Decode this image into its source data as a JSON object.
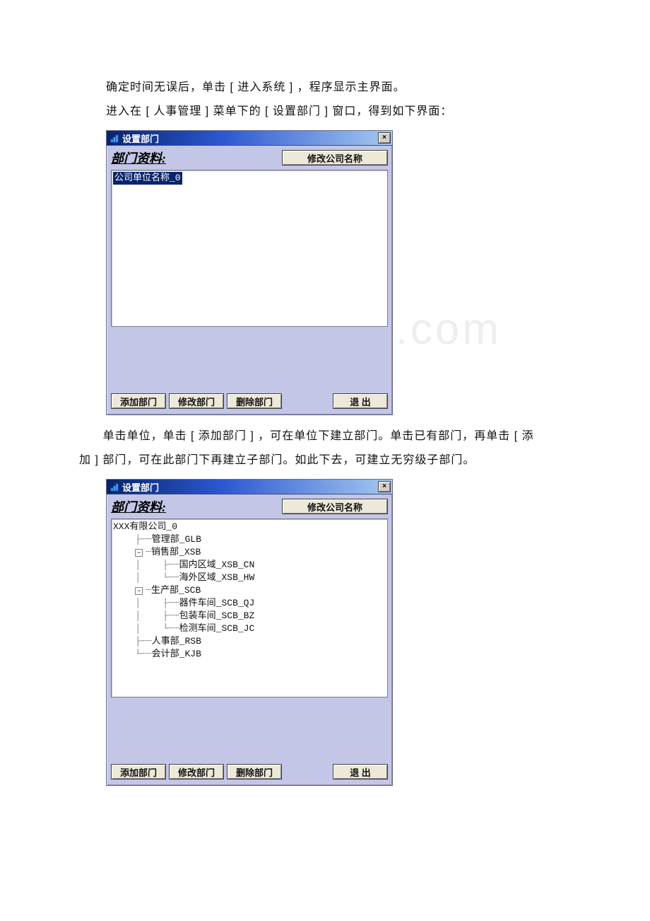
{
  "doc": {
    "line1": "确定时间无误后，单击 [ 进入系统 ] ，程序显示主界面。",
    "line2": "进入在 [ 人事管理 ] 菜单下的 [ 设置部门 ] 窗口，得到如下界面：",
    "line_mid_a": "单击单位，单击 [ 添加部门 ] ，可在单位下建立部门。单击已有部门，再单击 [ 添",
    "line_mid_b": "加 ] 部门，可在此部门下再建立子部门。如此下去，可建立无穷级子部门。",
    "watermark": "www.bdocx.com"
  },
  "dialog1": {
    "title": "设置部门",
    "close": "×",
    "label": "部门资料:",
    "modify_company": "修改公司名称",
    "tree_selected": "公司单位名称_0",
    "btn_add": "添加部门",
    "btn_edit": "修改部门",
    "btn_del": "删除部门",
    "btn_exit": "退 出"
  },
  "dialog2": {
    "title": "设置部门",
    "close": "×",
    "label": "部门资料:",
    "modify_company": "修改公司名称",
    "tree": {
      "root": "XXX有限公司_0",
      "n1": "管理部_GLB",
      "n2": "销售部_XSB",
      "n2a": "国内区域_XSB_CN",
      "n2b": "海外区域_XSB_HW",
      "n3": "生产部_SCB",
      "n3a": "器件车间_SCB_QJ",
      "n3b": "包装车间_SCB_BZ",
      "n3c": "检测车间_SCB_JC",
      "n4": "人事部_RSB",
      "n5": "会计部_KJB"
    },
    "btn_add": "添加部门",
    "btn_edit": "修改部门",
    "btn_del": "删除部门",
    "btn_exit": "退 出"
  }
}
